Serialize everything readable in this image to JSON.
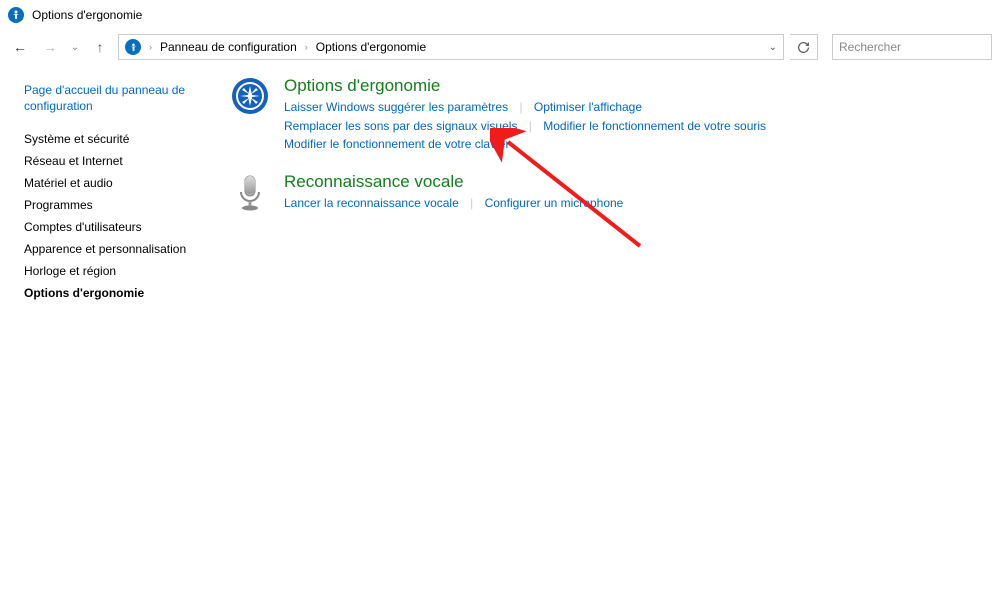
{
  "window": {
    "title": "Options d'ergonomie"
  },
  "breadcrumb": {
    "item0": "Panneau de configuration",
    "item1": "Options d'ergonomie"
  },
  "search": {
    "placeholder": "Rechercher"
  },
  "sidebar": {
    "home": "Page d'accueil du panneau de configuration",
    "items": {
      "0": "Système et sécurité",
      "1": "Réseau et Internet",
      "2": "Matériel et audio",
      "3": "Programmes",
      "4": "Comptes d'utilisateurs",
      "5": "Apparence et personnalisation",
      "6": "Horloge et région",
      "7": "Options d'ergonomie"
    }
  },
  "categories": {
    "ease": {
      "title": "Options d'ergonomie",
      "links": {
        "0": "Laisser Windows suggérer les paramètres",
        "1": "Optimiser l'affichage",
        "2": "Remplacer les sons par des signaux visuels",
        "3": "Modifier le fonctionnement de votre souris",
        "4": "Modifier le fonctionnement de votre clavier"
      }
    },
    "speech": {
      "title": "Reconnaissance vocale",
      "links": {
        "0": "Lancer la reconnaissance vocale",
        "1": "Configurer un microphone"
      }
    }
  }
}
